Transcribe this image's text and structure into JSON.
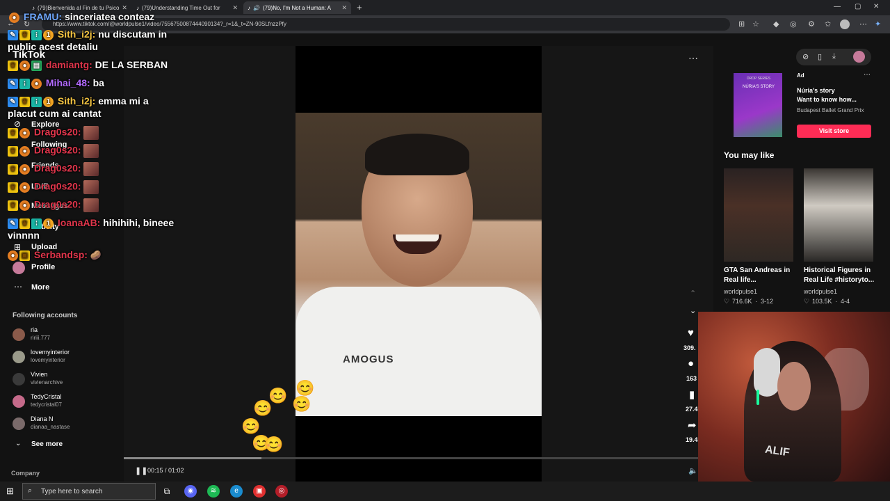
{
  "browser": {
    "tabs": [
      {
        "label": "(79)Bienvenida al Fin de tu Psico"
      },
      {
        "label": "(79)Understanding Time Out for"
      },
      {
        "label": "(79)No, I'm Not a Human: A"
      }
    ],
    "url": "https://www.tiktok.com/@worldpulse1/video/7556750087444090134?_r=1&_t=ZN-90SLfnzzPfy"
  },
  "tiktok": {
    "logo": "TikTok",
    "nav": {
      "explore": "Explore",
      "following": "Following",
      "friends": "Friends",
      "live": "LIVE",
      "messages": "Messages",
      "activity": "Activity",
      "upload": "Upload",
      "profile": "Profile",
      "more": "More"
    },
    "following_accounts_title": "Following accounts",
    "following_accounts": [
      {
        "name": "ria",
        "handle": "ririii.777"
      },
      {
        "name": "lovemyinterior",
        "handle": "lovemyinterior"
      },
      {
        "name": "Vivien",
        "handle": "vivienarchive"
      },
      {
        "name": "TedyCristal",
        "handle": "tedycristal07"
      },
      {
        "name": "Diana N",
        "handle": "dianaa_nastase"
      }
    ],
    "see_more": "See more",
    "company": "Company",
    "video": {
      "shirt_text": "AMOGUS",
      "timecode": "00:15 / 01:02",
      "progress": 0.24,
      "likes": "309.",
      "comments": "163",
      "saves": "27.4",
      "shares": "19.4"
    },
    "ad": {
      "label": "Ad",
      "image_title": "NÚRIA'S STORY",
      "image_subtitle": "DROP SERIES",
      "title": "Núria's story",
      "subtitle": "Want to know how...",
      "advertiser": "Budapest Ballet Grand Prix",
      "cta": "Visit store"
    },
    "you_may_like_title": "You may like",
    "recommended": [
      {
        "title_line1": "GTA San Andreas in",
        "title_line2": "Real life...",
        "author": "worldpulse1",
        "likes": "716.6K",
        "date": "3-12"
      },
      {
        "title_line1": "Historical Figures in",
        "title_line2": "Real Life #historyto...",
        "author": "worldpulse1",
        "likes": "103.5K",
        "date": "4-4"
      }
    ]
  },
  "chat": [
    {
      "user": "FRAMU:",
      "msg": "sinceriatea conteaz",
      "color": "#6fa8ff"
    },
    {
      "user": "Sith_i2j:",
      "msg": "nu discutam in",
      "msg2": "public acest detaliu",
      "color": "#f5c542"
    },
    {
      "user": "damiantg:",
      "msg": "DE LA SERBAN",
      "color": "#e0354b"
    },
    {
      "user": "Mihai_48:",
      "msg": "ba",
      "color": "#b36bff"
    },
    {
      "user": "Sith_i2j:",
      "msg": "emma mi a",
      "msg2": "placut cum ai cantat",
      "color": "#f5c542"
    },
    {
      "user": "Drag0s20:",
      "color": "#e0354b"
    },
    {
      "user": "Drag0s20:",
      "color": "#e0354b"
    },
    {
      "user": "Drag0s20:",
      "color": "#e0354b"
    },
    {
      "user": "Drag0s20:",
      "color": "#e0354b"
    },
    {
      "user": "Drag0s20:",
      "color": "#e0354b"
    },
    {
      "user": "IoanaAB:",
      "msg": "hihihihi, bineee",
      "msg2": "vinnnn",
      "color": "#e0354b"
    },
    {
      "user": "Serbandsp:",
      "color": "#e0354b"
    }
  ],
  "taskbar": {
    "search_placeholder": "Type here to search"
  }
}
